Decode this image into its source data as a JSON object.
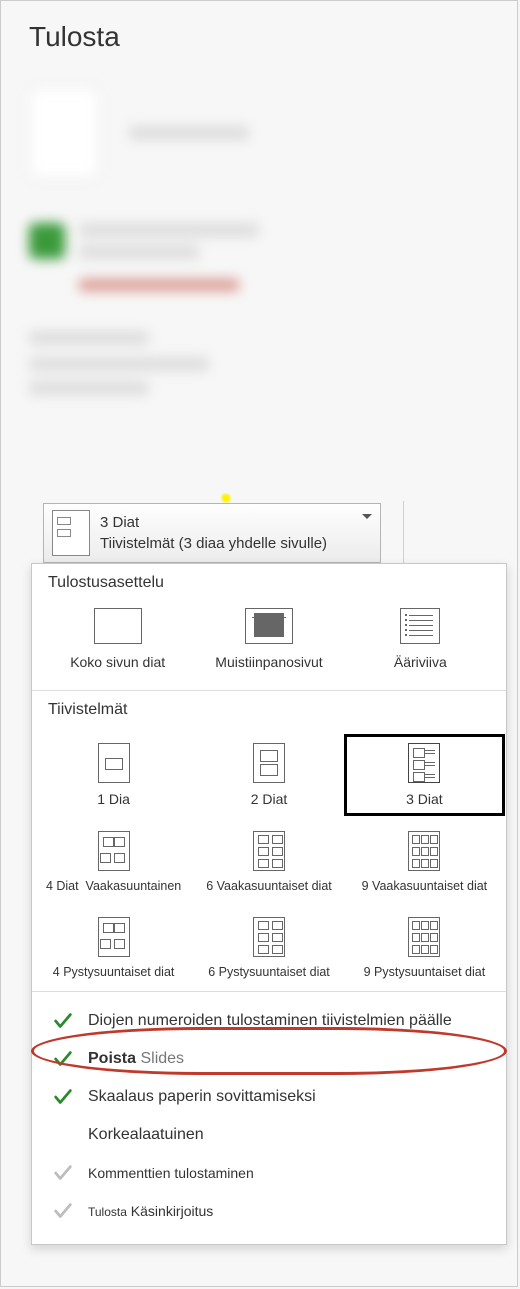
{
  "page": {
    "title": "Tulosta"
  },
  "dropdown": {
    "line1": "3 Diat",
    "line2": "Tiivistelmät (3 diaa yhdelle sivulle)"
  },
  "popup": {
    "section_layout_title": "Tulostusasettelu",
    "layout_options": {
      "full_page": "Koko sivun diat",
      "notes_pages": "Muistiinpanosivut",
      "outline": "Ääriviiva"
    },
    "section_handouts_title": "Tiivistelmät",
    "handouts_row1": {
      "a": "1 Dia",
      "b": "2 Diat",
      "c": "3 Diat"
    },
    "handouts_row2": {
      "a": "4 Diat",
      "b": "Vaakasuuntainen",
      "c": "6 Vaakasuuntaiset diat",
      "d": "9 Vaakasuuntaiset diat"
    },
    "handouts_row3": {
      "a": "4 Pystysuuntaiset diat",
      "b": "6 Pystysuuntaiset diat",
      "c": "9 Pystysuuntaiset diat"
    },
    "options": {
      "print_slide_numbers": "Diojen numeroiden tulostaminen tiivistelmien päälle",
      "remove": "Poista",
      "remove_suffix": "Slides",
      "scale_to_fit": "Skaalaus paperin sovittamiseksi",
      "high_quality": "Korkealaatuinen",
      "print_comments": "Kommenttien tulostaminen",
      "print_ink_prefix": "Tulosta",
      "print_ink": "Käsinkirjoitus"
    }
  }
}
